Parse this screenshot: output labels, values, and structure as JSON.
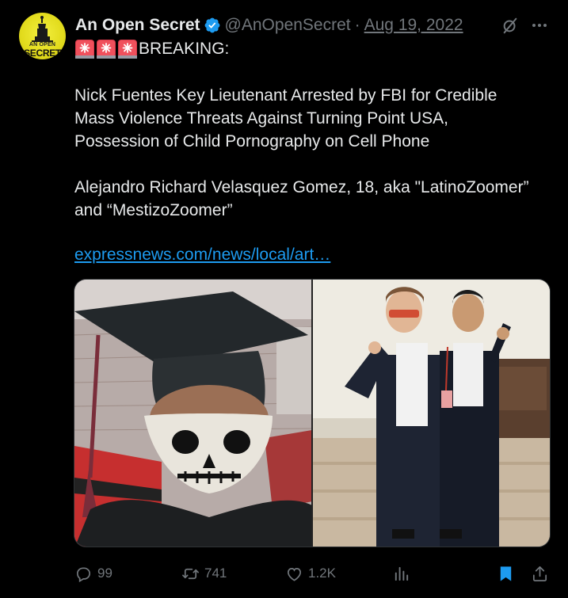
{
  "author": {
    "display_name": "An Open Secret",
    "handle": "@AnOpenSecret",
    "date": "Aug 19, 2022",
    "avatar_text_top": "AN OPEN",
    "avatar_text_bottom": "SECRET"
  },
  "tweet": {
    "emojis": [
      "police-siren",
      "police-siren",
      "police-siren"
    ],
    "breaking": "BREAKING:",
    "paragraph1": [
      "Nick Fuentes Key Lieutenant Arrested by FBI for Credible",
      "Mass Violence Threats Against Turning Point USA,",
      "Possession of Child Pornography on Cell Phone"
    ],
    "paragraph2": [
      "Alejandro Richard Velasquez Gomez, 18, aka \"LatinoZoomer”",
      "and “MestizoZoomer”"
    ],
    "link": "expressnews.com/news/local/art…"
  },
  "media": {
    "images": [
      "graduation-selfie-skull-mask",
      "two-men-in-suits-hallway"
    ]
  },
  "actions": {
    "replies": "99",
    "reposts": "741",
    "likes": "1.2K"
  },
  "colors": {
    "background": "#000000",
    "text": "#e7e9ea",
    "muted": "#71767b",
    "link": "#1d9bf0",
    "verified": "#1d9bf0"
  }
}
